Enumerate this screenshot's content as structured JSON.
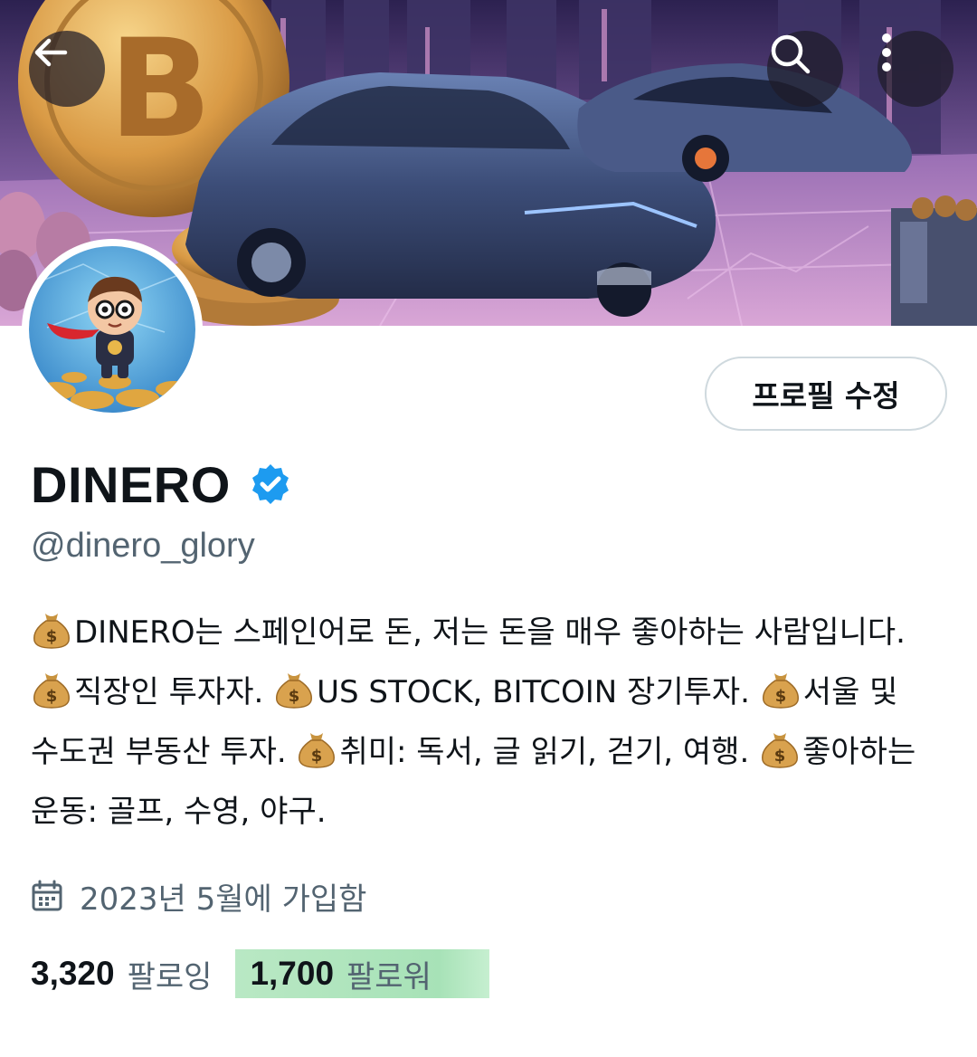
{
  "header": {
    "back_icon": "arrow-left-icon",
    "search_icon": "search-icon",
    "more_icon": "more-vertical-icon"
  },
  "profile": {
    "edit_button_label": "프로필 수정",
    "display_name": "DINERO",
    "verified_badge": "verified-check-icon",
    "handle": "@dinero_glory",
    "bio": [
      {
        "icon": "money-bag-icon",
        "text": "DINERO는 스페인어로 돈, 저는 돈을 매우 좋아하는 사람입니다. "
      },
      {
        "icon": "money-bag-icon",
        "text": "직장인 투자자. "
      },
      {
        "icon": "money-bag-icon",
        "text": "US STOCK, BITCOIN 장기투자. "
      },
      {
        "icon": "money-bag-icon",
        "text": "서울 및 수도권 부동산 투자. "
      },
      {
        "icon": "money-bag-icon",
        "text": "취미: 독서, 글 읽기, 걷기, 여행. "
      },
      {
        "icon": "money-bag-icon",
        "text": "좋아하는 운동: 골프, 수영, 야구."
      }
    ],
    "joined_icon": "calendar-icon",
    "joined_text": "2023년 5월에 가입함",
    "following_count": "3,320",
    "following_label": "팔로잉",
    "followers_count": "1,700",
    "followers_label": "팔로워"
  },
  "colors": {
    "text_primary": "#0f1419",
    "text_secondary": "#536471",
    "verified_blue": "#1d9bf0",
    "highlight_green": "#b9e8c4"
  }
}
